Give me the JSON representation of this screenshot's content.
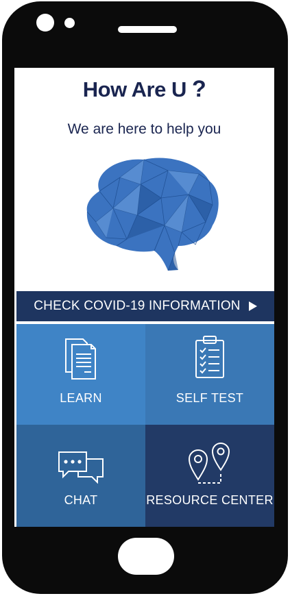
{
  "app": {
    "title": "How Are U",
    "title_mark": "?",
    "subtitle": "We are here to help you"
  },
  "banner": {
    "label": "CHECK COVID-19 INFORMATION"
  },
  "tiles": [
    {
      "label": "LEARN",
      "icon": "documents-icon"
    },
    {
      "label": "SELF TEST",
      "icon": "clipboard-checklist-icon"
    },
    {
      "label": "CHAT",
      "icon": "chat-bubbles-icon"
    },
    {
      "label": "RESOURCE CENTER",
      "icon": "map-pins-icon"
    }
  ],
  "colors": {
    "title": "#1a2550",
    "banner": "#1e3560",
    "learn": "#3f84c6",
    "self_test": "#3a78b5",
    "chat": "#2f6499",
    "resource_center": "#223a66",
    "brain": "#3b73c0"
  }
}
